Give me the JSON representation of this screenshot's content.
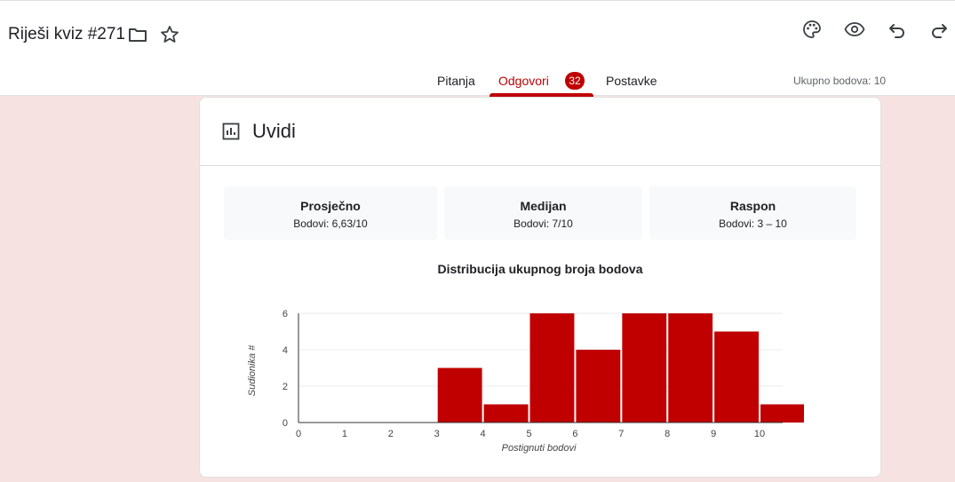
{
  "header": {
    "title": "Riješi kviz #271",
    "icons": [
      "folder-icon",
      "star-icon",
      "palette-icon",
      "eye-icon",
      "undo-icon",
      "redo-icon"
    ]
  },
  "tabs": [
    {
      "label": "Pitanja"
    },
    {
      "label": "Odgovori",
      "badge": "32",
      "active": true
    },
    {
      "label": "Postavke"
    }
  ],
  "total_points": "Ukupno bodova: 10",
  "insights": {
    "title": "Uvidi",
    "icon": "bar-chart-icon",
    "stats": [
      {
        "label": "Prosječno",
        "value": "Bodovi: 6,63/10"
      },
      {
        "label": "Medijan",
        "value": "Bodovi: 7/10"
      },
      {
        "label": "Raspon",
        "value": "Bodovi: 3 – 10"
      }
    ]
  },
  "colors": {
    "accent": "#c00000",
    "background": "#f7e2e2"
  },
  "chart_data": {
    "type": "bar",
    "title": "Distribucija ukupnog broja bodova",
    "xlabel": "Postignuti bodovi",
    "ylabel": "Sudionika #",
    "categories": [
      "0",
      "1",
      "2",
      "3",
      "4",
      "5",
      "6",
      "7",
      "8",
      "9",
      "10"
    ],
    "values": [
      0,
      0,
      0,
      3,
      1,
      6,
      4,
      6,
      6,
      5,
      1
    ],
    "y_ticks": [
      "0",
      "2",
      "4",
      "6"
    ],
    "ylim": [
      0,
      6
    ],
    "grid": true,
    "color": "#c00000"
  }
}
